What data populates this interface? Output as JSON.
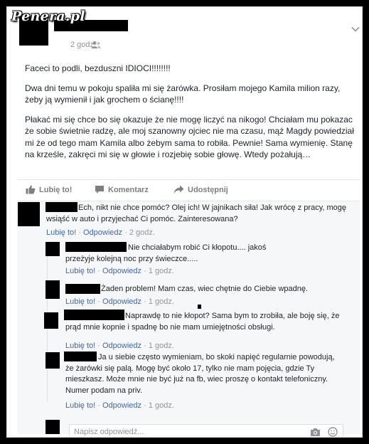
{
  "watermark": "Penera.pl",
  "post": {
    "time": "2 godz.",
    "separator": "·",
    "audience_icon": "friends-icon",
    "paragraphs": [
      "Faceci to podli, bezduszni IDIOCI!!!!!!!!",
      "Dwa dni temu w pokoju spaliła mi się żarówka. Prosiłam mojego Kamila milion razy, żeby ją wymienił i jak grochem o ścianę!!!!",
      "Płakać mi się chce bo się okazuje że nie mogę liczyć na nikogo! Chciałam mu pokazac że sobie świetnie radzę, ale moj szanowny ojciec nie ma czasu, mąż Magdy powiedział mi że od tego mam Kamila albo żebym sama to robiła. Pewnie! Sama wymienię. Stanę na krześle, zakręci mi się w głowie i rozjebię sobie głowę. Wtedy pożałują…"
    ]
  },
  "actions": {
    "like": "Lubię to!",
    "comment": "Komentarz",
    "share": "Udostępnij"
  },
  "comments": [
    {
      "text": "Ech, nikt nie chce pomóc? Olej ich! W jajnikach siła! Jak wrócę z pracy, mogę wsiąść w auto i przyjechać Ci pomóc. Zainteresowana?",
      "like": "Lubię to!",
      "reply": "Odpowiedz",
      "time": "2 godz."
    }
  ],
  "replies": [
    {
      "text": "Nie chciałabym robić Ci kłopotu.... jakoś przeżyje kolejną noc przy świeczce.....",
      "like": "Lubię to!",
      "reply": "Odpowiedz",
      "time": "1 godz."
    },
    {
      "text": "Żaden problem! Mam czas, wiec chętnie do Ciebie wpadnę.",
      "like": "Lubię to!",
      "reply": "Odpowiedz",
      "time": "1 godz."
    },
    {
      "text": "Naprawdę to nie kłopot? Sama bym to zrobiła, ale boję się, że prąd mnie kopnie i spadnę bo nie mam umiejętności obsługi.",
      "like": "Lubię to!",
      "reply": "Odpowiedz",
      "time": "1 godz."
    },
    {
      "text": "Ja u siebie często wymieniam, bo skoki napięć regularnie powodują, że żarówki się palą. Mogę być około 17, tylko nie mam pojęcia, gdzie Ty mieszkasz. Może mnie nie być już na fb, wiec proszę o kontakt telefoniczny. Numer podam na priv.",
      "like": "Lubię to!",
      "reply": "Odpowiedz",
      "time": "1 godz."
    }
  ],
  "reply_box": {
    "placeholder": "Napisz odpowiedź...",
    "camera_icon": "camera-icon",
    "emoji_icon": "emoji-icon"
  },
  "colors": {
    "link": "#4267b2",
    "meta": "#90949c",
    "comments_bg": "#f6f7f9"
  }
}
